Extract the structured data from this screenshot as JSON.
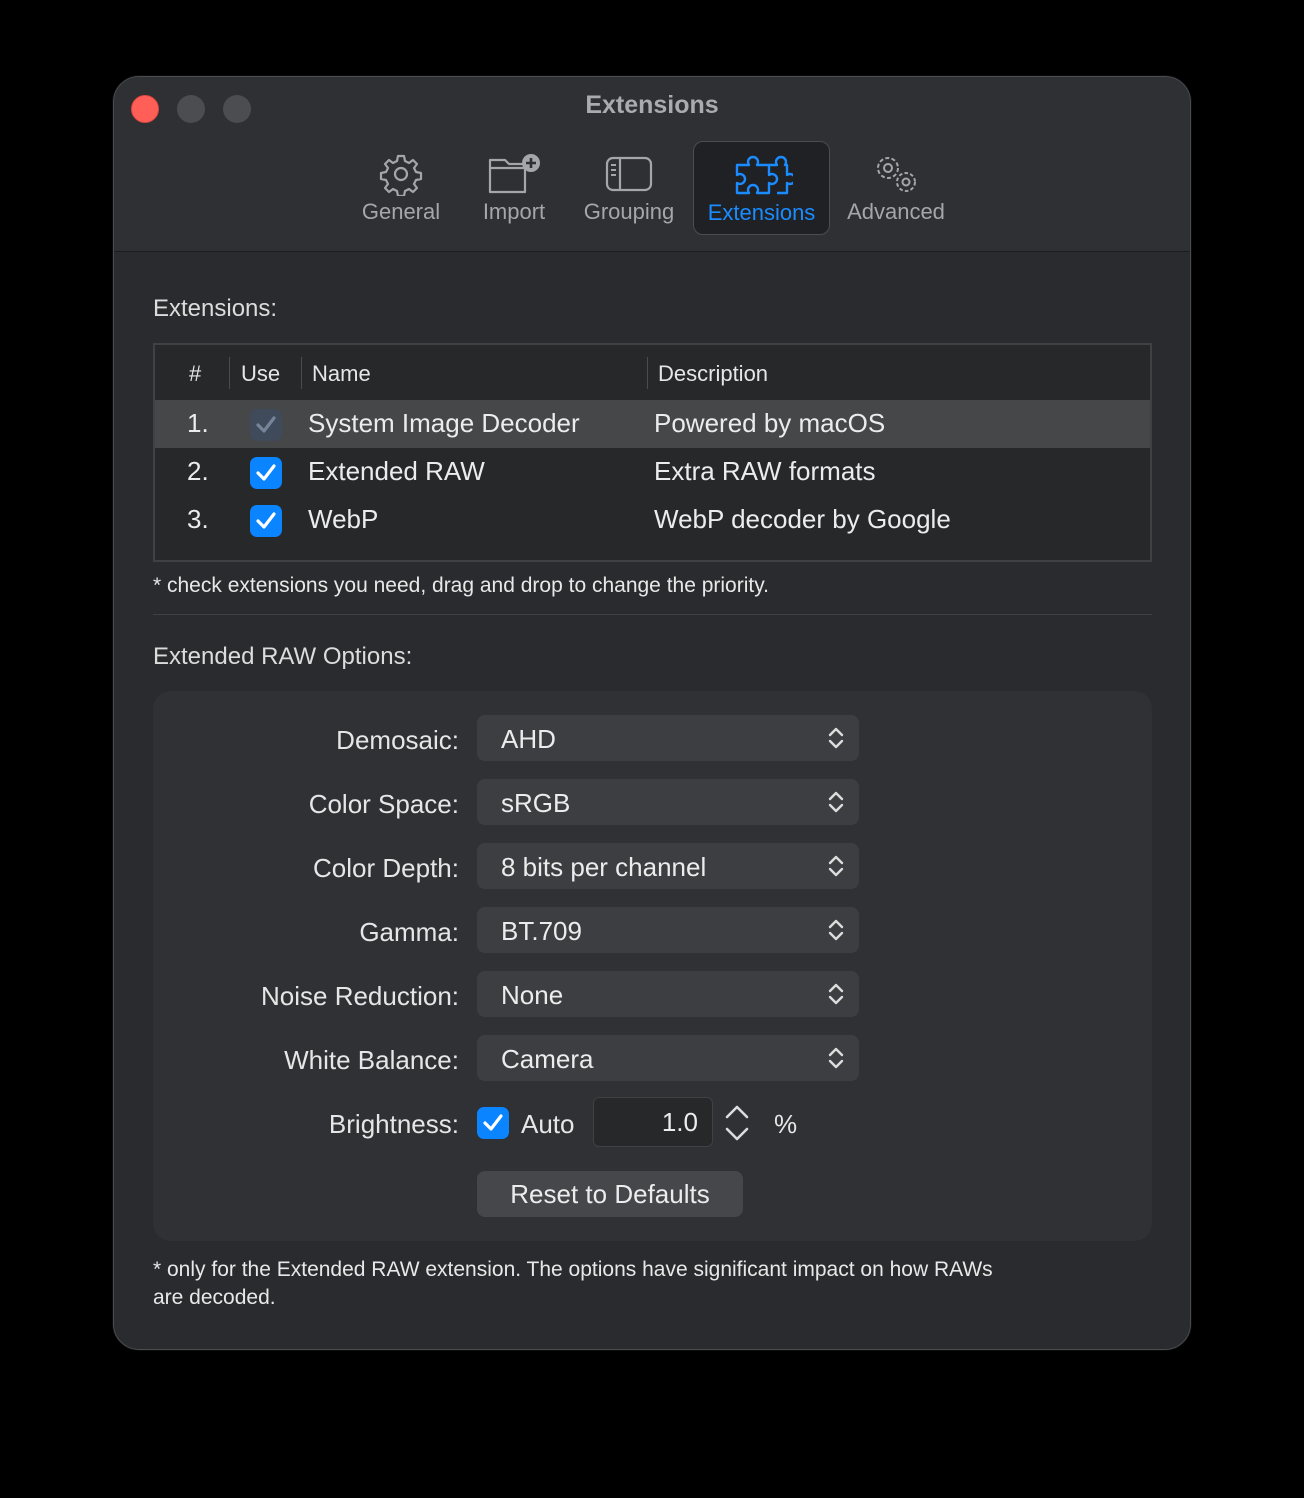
{
  "window": {
    "title": "Extensions"
  },
  "toolbar": {
    "items": [
      {
        "label": "General",
        "icon": "gear-icon"
      },
      {
        "label": "Import",
        "icon": "folder-add-icon"
      },
      {
        "label": "Grouping",
        "icon": "sidebar-icon"
      },
      {
        "label": "Extensions",
        "icon": "puzzle-icon",
        "active": true
      },
      {
        "label": "Advanced",
        "icon": "gears-icon"
      }
    ]
  },
  "extensions": {
    "section_label": "Extensions:",
    "columns": {
      "num": "#",
      "use": "Use",
      "name": "Name",
      "description": "Description"
    },
    "rows": [
      {
        "num": "1.",
        "use": true,
        "enabled": false,
        "name": "System Image Decoder",
        "description": "Powered by macOS",
        "selected": true
      },
      {
        "num": "2.",
        "use": true,
        "enabled": true,
        "name": "Extended RAW",
        "description": "Extra RAW formats",
        "selected": false
      },
      {
        "num": "3.",
        "use": true,
        "enabled": true,
        "name": "WebP",
        "description": "WebP decoder by Google",
        "selected": false
      }
    ],
    "note": "* check extensions you need, drag and drop to change the priority."
  },
  "raw_options": {
    "section_label": "Extended RAW Options:",
    "demosaic": {
      "label": "Demosaic:",
      "value": "AHD"
    },
    "color_space": {
      "label": "Color Space:",
      "value": "sRGB"
    },
    "color_depth": {
      "label": "Color Depth:",
      "value": "8 bits per channel"
    },
    "gamma": {
      "label": "Gamma:",
      "value": "BT.709"
    },
    "noise_reduction": {
      "label": "Noise Reduction:",
      "value": "None"
    },
    "white_balance": {
      "label": "White Balance:",
      "value": "Camera"
    },
    "brightness": {
      "label": "Brightness:",
      "auto_label": "Auto",
      "auto": true,
      "value": "1.0",
      "unit": "%"
    },
    "reset_label": "Reset to Defaults",
    "note_line1": "* only for the Extended RAW extension. The options have significant impact on how RAWs",
    "note_line2": "are decoded."
  },
  "colors": {
    "accent": "#0a84ff",
    "close": "#ff5f57",
    "window_bg": "#292b2e"
  }
}
